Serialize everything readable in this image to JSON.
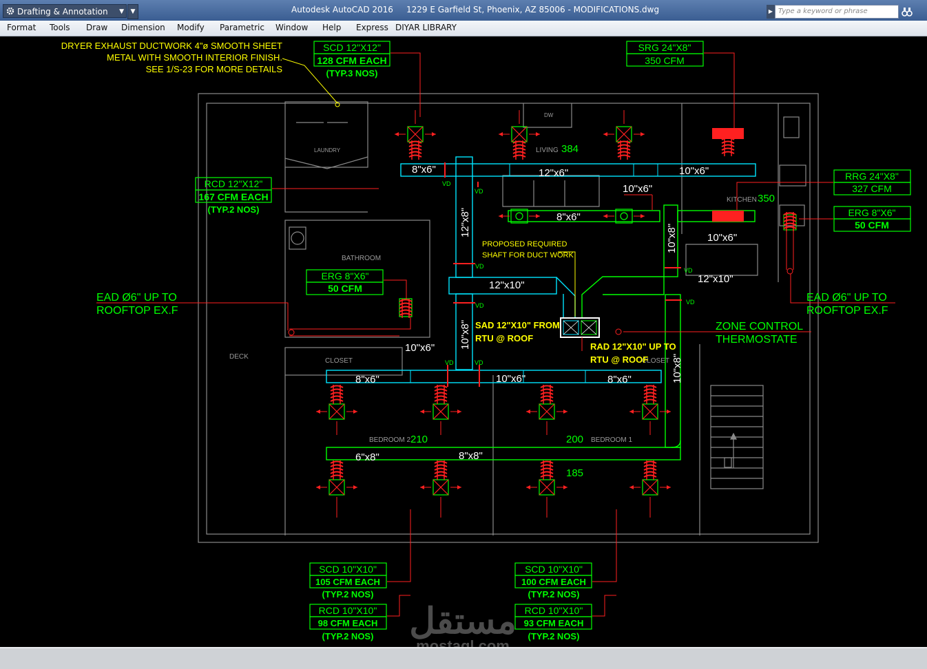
{
  "titlebar": {
    "workspace": "Drafting & Annotation",
    "app_title": "Autodesk AutoCAD 2016",
    "file_title": "1229 E Garfield St, Phoenix, AZ 85006 - MODIFICATIONS.dwg",
    "search_placeholder": "Type a keyword or phrase"
  },
  "menu": [
    "Format",
    "Tools",
    "Draw",
    "Dimension",
    "Modify",
    "Parametric",
    "Window",
    "Help",
    "Express",
    "DIYAR LIBRARY"
  ],
  "drawing": {
    "dryer_note": [
      "DRYER EXHAUST DUCTWORK 4\"ø SMOOTH SHEET",
      "METAL  WITH SMOOTH INTERIOR FINISH.",
      "SEE 1/S-23  FOR MORE DETAILS"
    ],
    "scd_top": [
      "SCD 12\"X12\"",
      "128 CFM EACH",
      "(TYP.3 NOS)"
    ],
    "srg": [
      "SRG 24\"X8\"",
      "350 CFM"
    ],
    "rcd_left": [
      "RCD 12\"X12\"",
      "167 CFM EACH",
      "(TYP.2 NOS)"
    ],
    "rrg": [
      "RRG 24\"X8\"",
      "327 CFM"
    ],
    "erg_right": [
      "ERG 8\"X6\"",
      "50 CFM"
    ],
    "erg_left": [
      "ERG 8\"X6\"",
      "50 CFM"
    ],
    "ead_left": [
      "EAD Ø6\" UP TO",
      "ROOFTOP EX.F"
    ],
    "ead_right": [
      "EAD Ø6\" UP TO",
      "ROOFTOP EX.F"
    ],
    "zone": [
      "ZONE CONTROL",
      "THERMOSTATE"
    ],
    "shaft_note": [
      "PROPOSED REQUIRED",
      "SHAFT FOR DUCT WORK"
    ],
    "sad": [
      "SAD 12\"X10\" FROM",
      "RTU @ ROOF"
    ],
    "rad": [
      "RAD 12\"X10\" UP TO",
      "RTU @ ROOF"
    ],
    "scd_bl": [
      "SCD 10\"X10\"",
      "105 CFM EACH",
      "(TYP.2 NOS)"
    ],
    "rcd_bl": [
      "RCD 10\"X10\"",
      "98 CFM EACH",
      "(TYP.2 NOS)"
    ],
    "scd_br": [
      "SCD 10\"X10\"",
      "100 CFM EACH",
      "(TYP.2 NOS)"
    ],
    "rcd_br": [
      "RCD 10\"X10\"",
      "93 CFM EACH",
      "(TYP.2 NOS)"
    ],
    "duct_labels": {
      "d1": "8\"x6\"",
      "d2": "12\"x6\"",
      "d3": "10\"x6\"",
      "d4": "10\"x6\"",
      "d5": "8\"x6\"",
      "d6": "10\"x6\"",
      "d7": "12\"x10\"",
      "d8": "12\"x10\"",
      "d9": "10\"x6\"",
      "d10": "8\"x6\"",
      "d11": "10\"x6\"",
      "d12": "8\"x6\"",
      "d13": "6\"x8\"",
      "d14": "8\"x8\"",
      "v1": "12\"x8\"",
      "v2": "10\"x8\"",
      "v3": "10\"x8\"",
      "v4": "10\"x8\""
    },
    "vd": "VD",
    "rooms": {
      "living": "LIVING",
      "living_n": "384",
      "kitchen": "KITCHEN",
      "kitchen_n": "350",
      "laundry": "LAUNDRY",
      "bathroom": "BATHROOM",
      "deck": "DECK",
      "closet1": "CLOSET",
      "closet2": "CLOSET",
      "bedroom2": "BEDROOM 2",
      "bedroom2_n": "210",
      "bedroom1": "BEDROOM 1",
      "bedroom1_n": "200",
      "n185": "185",
      "dw": "DW"
    }
  },
  "watermark": {
    "arabic": "مستقل",
    "latin": "mostaql.com"
  }
}
